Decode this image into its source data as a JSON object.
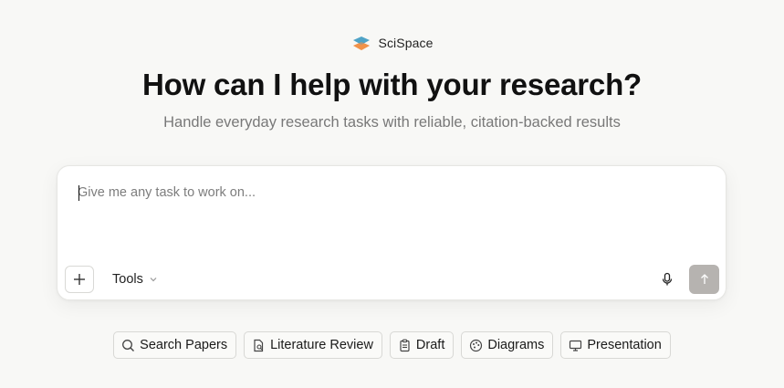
{
  "brand": {
    "name": "SciSpace",
    "logo_icon": "scispace-logo-icon",
    "logo_colors": [
      "#4fa3c7",
      "#f0924a"
    ]
  },
  "hero": {
    "title": "How can I help with your research?",
    "subtitle": "Handle everyday research tasks with reliable, citation-backed results"
  },
  "composer": {
    "placeholder": "Give me any task to work on...",
    "value": "",
    "add_icon": "plus-icon",
    "tools_label": "Tools",
    "tools_icon": "chevron-down-icon",
    "mic_icon": "microphone-icon",
    "send_icon": "arrow-up-icon",
    "send_color": "#b6b3b0"
  },
  "quick_actions": [
    {
      "label": "Search Papers",
      "icon": "search-icon"
    },
    {
      "label": "Literature Review",
      "icon": "document-search-icon"
    },
    {
      "label": "Draft",
      "icon": "clipboard-icon"
    },
    {
      "label": "Diagrams",
      "icon": "palette-icon"
    },
    {
      "label": "Presentation",
      "icon": "monitor-icon"
    }
  ]
}
